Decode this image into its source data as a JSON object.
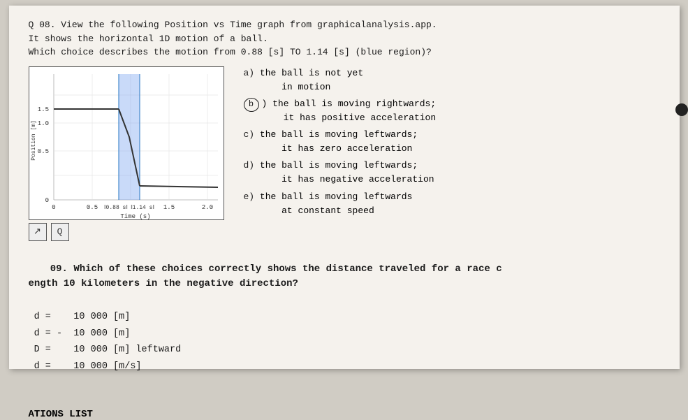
{
  "header": {
    "q08_text": "Q 08. View the following Position vs Time graph from graphicalanalysis.app.\nIt shows the horizontal 1D motion of a ball.\nWhich choice describes the motion from 0.88 [s] TO 1.14 [s] (blue region)?",
    "q09_title": "09. Which of these choices correctly shows the distance traveled for a race c\nength 10 kilometers in the negative direction?",
    "q09_answers": " d =    10 000 [m]\n d = -  10 000 [m]\n D =    10 000 [m] leftward\n d =    10 000 [m/s]",
    "ations_label": "ATIONS LIST"
  },
  "choices": [
    {
      "label": "a)",
      "text": "the ball is not yet\n    in motion",
      "circled": false
    },
    {
      "label": "b)",
      "text": "the ball is moving rightwards;\n    it has positive acceleration",
      "circled": true
    },
    {
      "label": "c)",
      "text": "the ball is moving leftwards;\n    it has zero acceleration",
      "circled": false
    },
    {
      "label": "d)",
      "text": "the ball is moving leftwards;\n    it has negative acceleration",
      "circled": false
    },
    {
      "label": "e)",
      "text": "the ball is moving leftwards\n    at constant speed",
      "circled": false
    }
  ],
  "graph": {
    "xlabel": "Time (s)",
    "ylabel": "Position [m]",
    "y_labels": [
      "1.5",
      "1.0",
      "0.5",
      "0"
    ],
    "x_labels": [
      "0",
      "0.5",
      "0.88 s | 1.14 s |",
      "1.5",
      "2.0"
    ]
  },
  "buttons": {
    "arrow_label": "↗",
    "zoom_label": "Q"
  }
}
